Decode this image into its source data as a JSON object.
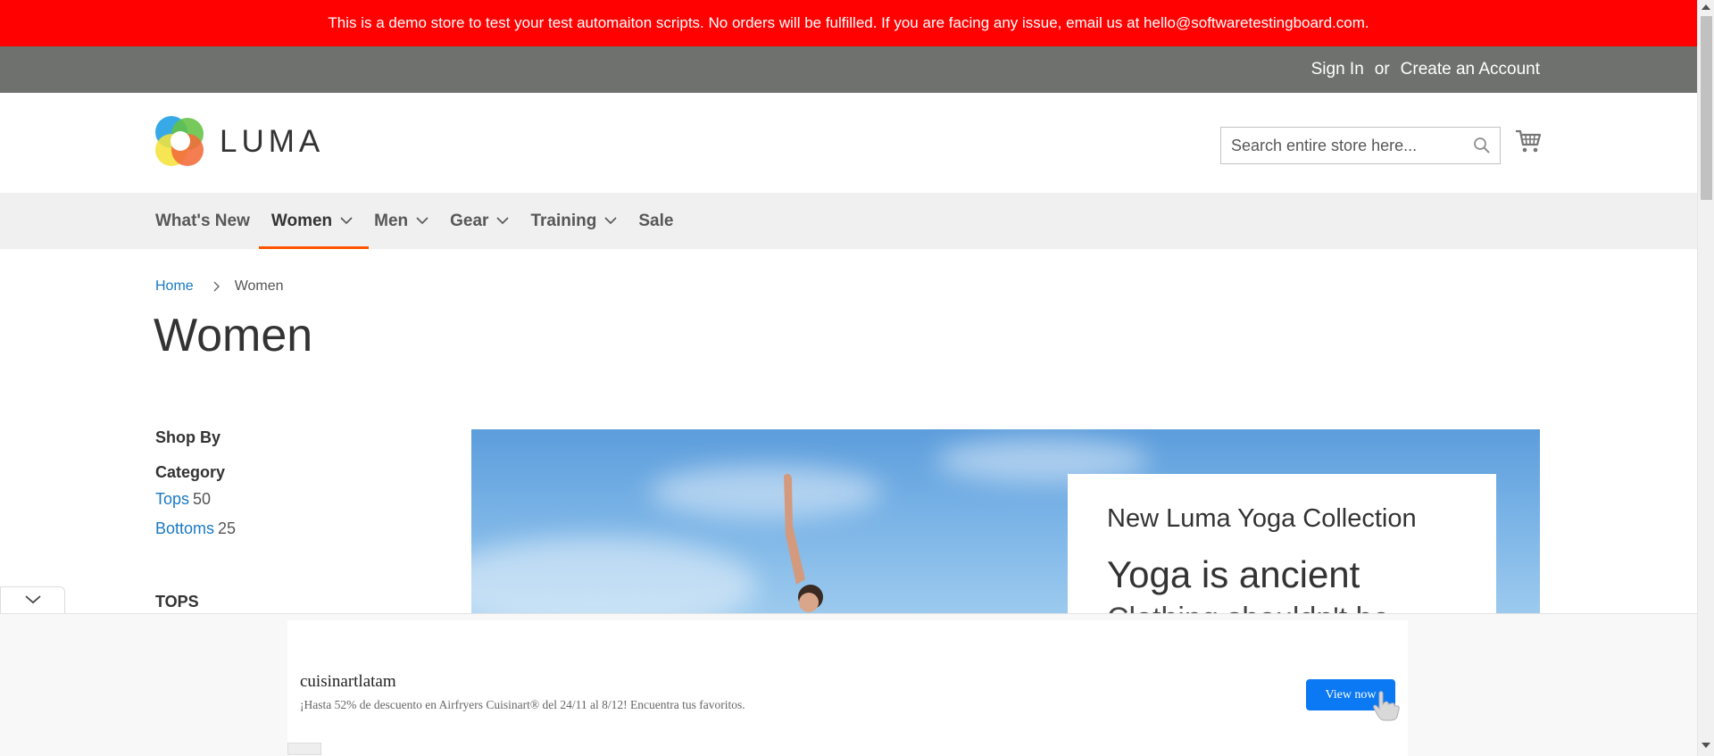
{
  "demo_banner": {
    "text": "This is a demo store to test your test automaiton scripts. No orders will be fulfilled. If you are facing any issue, email us at hello@softwaretestingboard.com."
  },
  "top_links": {
    "sign_in": "Sign In",
    "or": "or",
    "create_account": "Create an Account"
  },
  "header": {
    "logo_text": "LUMA",
    "search_placeholder": "Search entire store here...",
    "search_icon": "search-icon",
    "cart_icon": "shopping-cart-icon"
  },
  "nav": {
    "items": [
      {
        "label": "What's New",
        "has_dropdown": false,
        "active": false
      },
      {
        "label": "Women",
        "has_dropdown": true,
        "active": true
      },
      {
        "label": "Men",
        "has_dropdown": true,
        "active": false
      },
      {
        "label": "Gear",
        "has_dropdown": true,
        "active": false
      },
      {
        "label": "Training",
        "has_dropdown": true,
        "active": false
      },
      {
        "label": "Sale",
        "has_dropdown": false,
        "active": false
      }
    ]
  },
  "breadcrumb": {
    "home": "Home",
    "current": "Women"
  },
  "page_title": "Women",
  "sidebar": {
    "shop_by": "Shop By",
    "category_title": "Category",
    "categories": [
      {
        "label": "Tops",
        "count": "50"
      },
      {
        "label": "Bottoms",
        "count": "25"
      }
    ],
    "tops_heading": "TOPS"
  },
  "hero": {
    "subtitle": "New Luma Yoga Collection",
    "headline": "Yoga is ancient",
    "headline_line2": "Clothing shouldn't be"
  },
  "ad": {
    "title": "cuisinartlatam",
    "description": "¡Hasta 52% de descuento en Airfryers Cuisinart® del 24/11 al 8/12! Encuentra tus favoritos.",
    "button_label": "View now"
  },
  "colors": {
    "banner_red": "#ff0101",
    "topbar_gray": "#6e716e",
    "link_blue": "#1979c3",
    "nav_active_underline": "#ff5501",
    "ad_button_blue": "#0b79f3"
  }
}
